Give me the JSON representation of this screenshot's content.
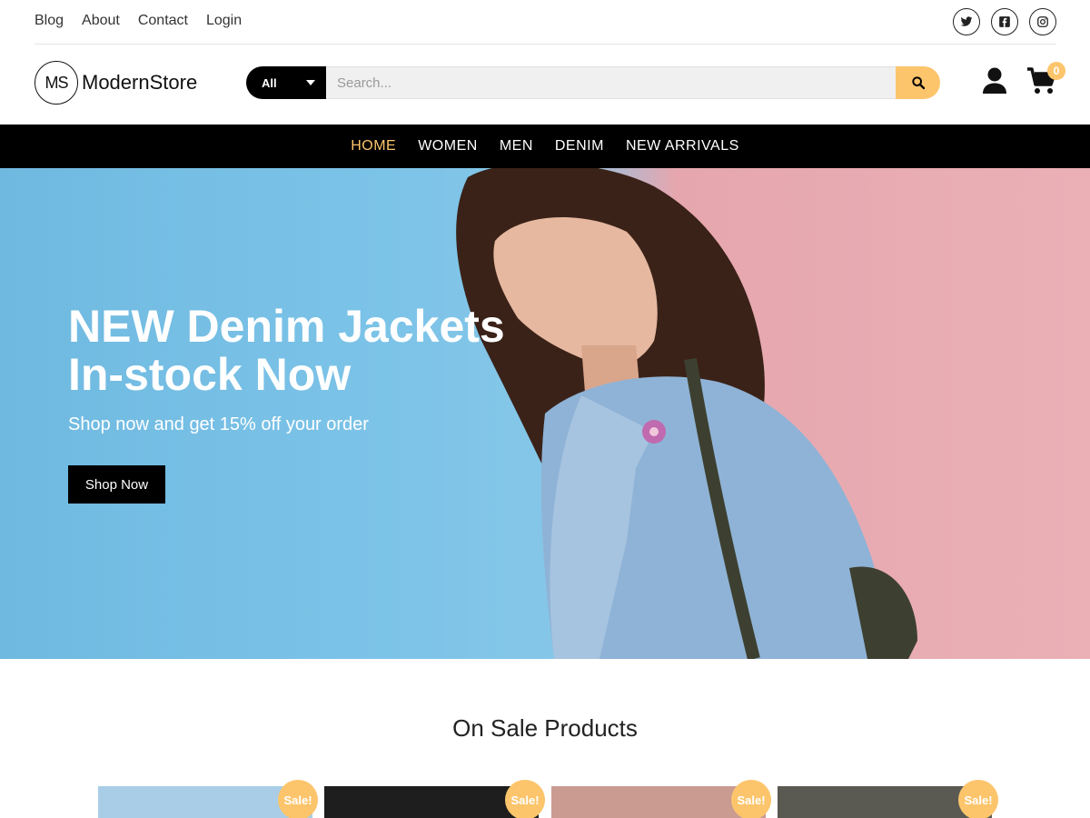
{
  "top_links": [
    "Blog",
    "About",
    "Contact",
    "Login"
  ],
  "socials": [
    "twitter-icon",
    "facebook-icon",
    "instagram-icon"
  ],
  "logo": {
    "mark": "MS",
    "text": "ModernStore"
  },
  "search": {
    "category": "All",
    "placeholder": "Search..."
  },
  "cart": {
    "count": "0"
  },
  "nav": [
    {
      "label": "HOME",
      "active": true
    },
    {
      "label": "WOMEN",
      "active": false
    },
    {
      "label": "MEN",
      "active": false
    },
    {
      "label": "DENIM",
      "active": false
    },
    {
      "label": "NEW ARRIVALS",
      "active": false
    }
  ],
  "hero": {
    "title_line1": "NEW Denim Jackets",
    "title_line2": "In-stock Now",
    "subtitle": "Shop now and get 15% off your order",
    "button": "Shop Now"
  },
  "section": {
    "title": "On Sale Products"
  },
  "products": [
    {
      "badge": "Sale!",
      "color": "#a9cde6"
    },
    {
      "badge": "Sale!",
      "color": "#1e1e1e"
    },
    {
      "badge": "Sale!",
      "color": "#c99b91"
    },
    {
      "badge": "Sale!",
      "color": "#5a5a52"
    }
  ],
  "colors": {
    "accent": "#fcc56c",
    "nav_bg": "#000000"
  }
}
